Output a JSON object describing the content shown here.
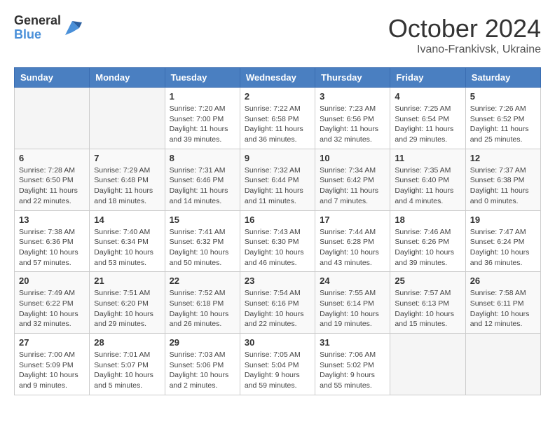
{
  "header": {
    "logo_general": "General",
    "logo_blue": "Blue",
    "month_title": "October 2024",
    "location": "Ivano-Frankivsk, Ukraine"
  },
  "columns": [
    "Sunday",
    "Monday",
    "Tuesday",
    "Wednesday",
    "Thursday",
    "Friday",
    "Saturday"
  ],
  "weeks": [
    [
      {
        "day": "",
        "info": ""
      },
      {
        "day": "",
        "info": ""
      },
      {
        "day": "1",
        "info": "Sunrise: 7:20 AM\nSunset: 7:00 PM\nDaylight: 11 hours and 39 minutes."
      },
      {
        "day": "2",
        "info": "Sunrise: 7:22 AM\nSunset: 6:58 PM\nDaylight: 11 hours and 36 minutes."
      },
      {
        "day": "3",
        "info": "Sunrise: 7:23 AM\nSunset: 6:56 PM\nDaylight: 11 hours and 32 minutes."
      },
      {
        "day": "4",
        "info": "Sunrise: 7:25 AM\nSunset: 6:54 PM\nDaylight: 11 hours and 29 minutes."
      },
      {
        "day": "5",
        "info": "Sunrise: 7:26 AM\nSunset: 6:52 PM\nDaylight: 11 hours and 25 minutes."
      }
    ],
    [
      {
        "day": "6",
        "info": "Sunrise: 7:28 AM\nSunset: 6:50 PM\nDaylight: 11 hours and 22 minutes."
      },
      {
        "day": "7",
        "info": "Sunrise: 7:29 AM\nSunset: 6:48 PM\nDaylight: 11 hours and 18 minutes."
      },
      {
        "day": "8",
        "info": "Sunrise: 7:31 AM\nSunset: 6:46 PM\nDaylight: 11 hours and 14 minutes."
      },
      {
        "day": "9",
        "info": "Sunrise: 7:32 AM\nSunset: 6:44 PM\nDaylight: 11 hours and 11 minutes."
      },
      {
        "day": "10",
        "info": "Sunrise: 7:34 AM\nSunset: 6:42 PM\nDaylight: 11 hours and 7 minutes."
      },
      {
        "day": "11",
        "info": "Sunrise: 7:35 AM\nSunset: 6:40 PM\nDaylight: 11 hours and 4 minutes."
      },
      {
        "day": "12",
        "info": "Sunrise: 7:37 AM\nSunset: 6:38 PM\nDaylight: 11 hours and 0 minutes."
      }
    ],
    [
      {
        "day": "13",
        "info": "Sunrise: 7:38 AM\nSunset: 6:36 PM\nDaylight: 10 hours and 57 minutes."
      },
      {
        "day": "14",
        "info": "Sunrise: 7:40 AM\nSunset: 6:34 PM\nDaylight: 10 hours and 53 minutes."
      },
      {
        "day": "15",
        "info": "Sunrise: 7:41 AM\nSunset: 6:32 PM\nDaylight: 10 hours and 50 minutes."
      },
      {
        "day": "16",
        "info": "Sunrise: 7:43 AM\nSunset: 6:30 PM\nDaylight: 10 hours and 46 minutes."
      },
      {
        "day": "17",
        "info": "Sunrise: 7:44 AM\nSunset: 6:28 PM\nDaylight: 10 hours and 43 minutes."
      },
      {
        "day": "18",
        "info": "Sunrise: 7:46 AM\nSunset: 6:26 PM\nDaylight: 10 hours and 39 minutes."
      },
      {
        "day": "19",
        "info": "Sunrise: 7:47 AM\nSunset: 6:24 PM\nDaylight: 10 hours and 36 minutes."
      }
    ],
    [
      {
        "day": "20",
        "info": "Sunrise: 7:49 AM\nSunset: 6:22 PM\nDaylight: 10 hours and 32 minutes."
      },
      {
        "day": "21",
        "info": "Sunrise: 7:51 AM\nSunset: 6:20 PM\nDaylight: 10 hours and 29 minutes."
      },
      {
        "day": "22",
        "info": "Sunrise: 7:52 AM\nSunset: 6:18 PM\nDaylight: 10 hours and 26 minutes."
      },
      {
        "day": "23",
        "info": "Sunrise: 7:54 AM\nSunset: 6:16 PM\nDaylight: 10 hours and 22 minutes."
      },
      {
        "day": "24",
        "info": "Sunrise: 7:55 AM\nSunset: 6:14 PM\nDaylight: 10 hours and 19 minutes."
      },
      {
        "day": "25",
        "info": "Sunrise: 7:57 AM\nSunset: 6:13 PM\nDaylight: 10 hours and 15 minutes."
      },
      {
        "day": "26",
        "info": "Sunrise: 7:58 AM\nSunset: 6:11 PM\nDaylight: 10 hours and 12 minutes."
      }
    ],
    [
      {
        "day": "27",
        "info": "Sunrise: 7:00 AM\nSunset: 5:09 PM\nDaylight: 10 hours and 9 minutes."
      },
      {
        "day": "28",
        "info": "Sunrise: 7:01 AM\nSunset: 5:07 PM\nDaylight: 10 hours and 5 minutes."
      },
      {
        "day": "29",
        "info": "Sunrise: 7:03 AM\nSunset: 5:06 PM\nDaylight: 10 hours and 2 minutes."
      },
      {
        "day": "30",
        "info": "Sunrise: 7:05 AM\nSunset: 5:04 PM\nDaylight: 9 hours and 59 minutes."
      },
      {
        "day": "31",
        "info": "Sunrise: 7:06 AM\nSunset: 5:02 PM\nDaylight: 9 hours and 55 minutes."
      },
      {
        "day": "",
        "info": ""
      },
      {
        "day": "",
        "info": ""
      }
    ]
  ]
}
